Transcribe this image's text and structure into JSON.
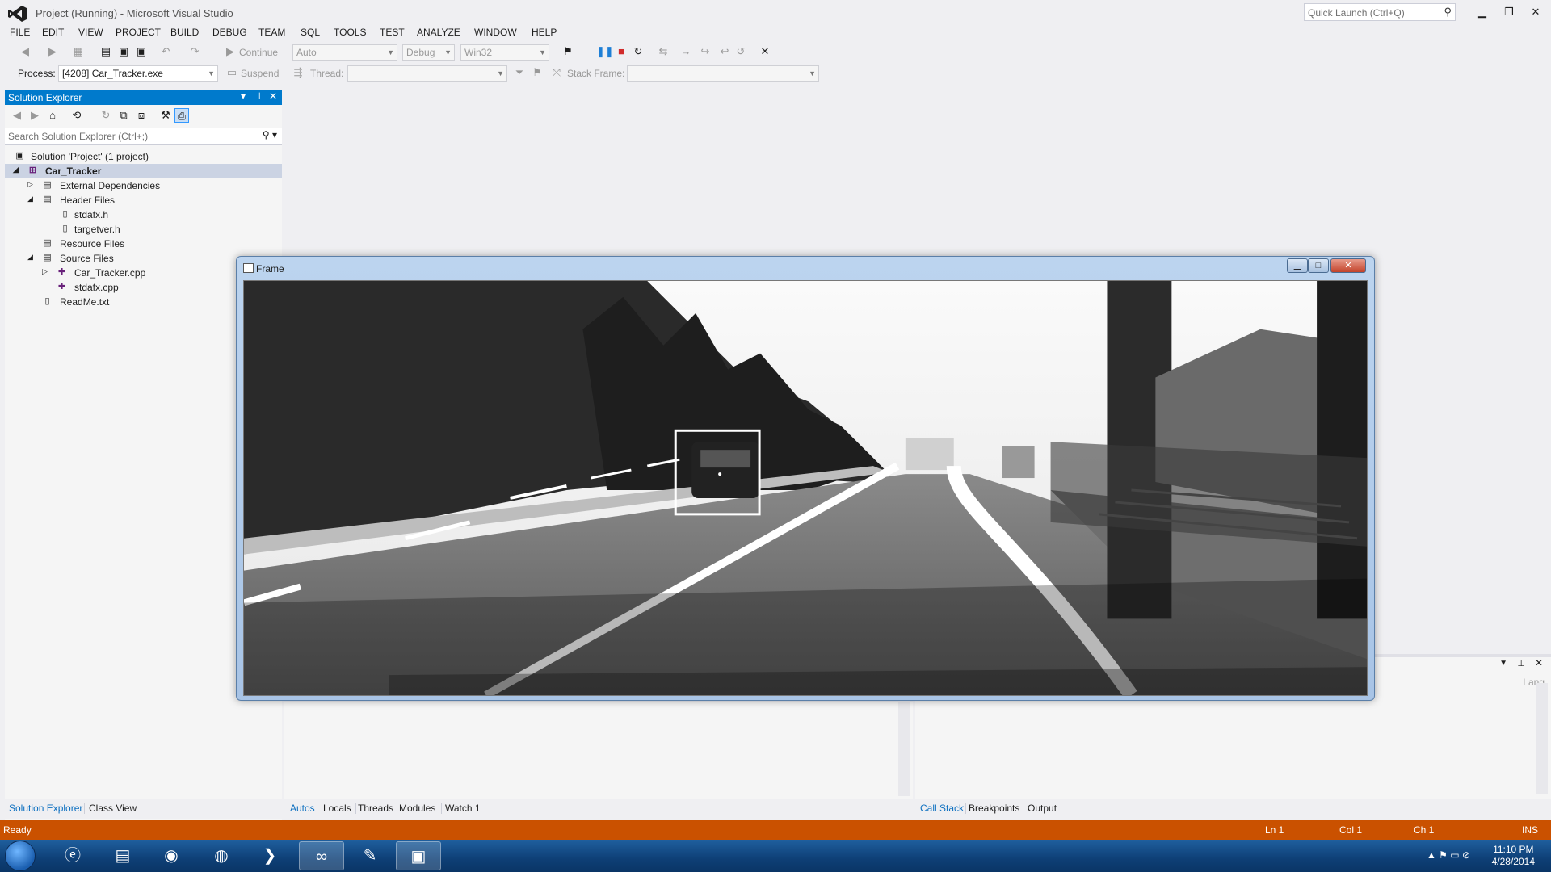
{
  "window": {
    "title": "Project (Running) - Microsoft Visual Studio",
    "quick_launch_placeholder": "Quick Launch (Ctrl+Q)"
  },
  "menu": [
    "FILE",
    "EDIT",
    "VIEW",
    "PROJECT",
    "BUILD",
    "DEBUG",
    "TEAM",
    "SQL",
    "TOOLS",
    "TEST",
    "ANALYZE",
    "WINDOW",
    "HELP"
  ],
  "toolbar": {
    "continue_label": "Continue",
    "config_auto": "Auto",
    "config_debug": "Debug",
    "platform": "Win32",
    "process_label": "Process:",
    "process_value": "[4208] Car_Tracker.exe",
    "suspend_label": "Suspend",
    "thread_label": "Thread:",
    "stack_frame_label": "Stack Frame:"
  },
  "solution_explorer": {
    "title": "Solution Explorer",
    "search_placeholder": "Search Solution Explorer (Ctrl+;)",
    "items": [
      {
        "label": "Solution 'Project' (1 project)"
      },
      {
        "label": "Car_Tracker"
      },
      {
        "label": "External Dependencies"
      },
      {
        "label": "Header Files"
      },
      {
        "label": "stdafx.h"
      },
      {
        "label": "targetver.h"
      },
      {
        "label": "Resource Files"
      },
      {
        "label": "Source Files"
      },
      {
        "label": "Car_Tracker.cpp"
      },
      {
        "label": "stdafx.cpp"
      },
      {
        "label": "ReadMe.txt"
      }
    ]
  },
  "bottom_tabs": {
    "left": [
      "Solution Explorer",
      "Class View"
    ],
    "middle": [
      "Autos",
      "Locals",
      "Threads",
      "Modules",
      "Watch 1"
    ],
    "right": [
      "Call Stack",
      "Breakpoints",
      "Output"
    ]
  },
  "panel_partial_text": "Lang",
  "frame_window": {
    "title": "Frame"
  },
  "status": {
    "ready": "Ready",
    "ln": "Ln 1",
    "col": "Col 1",
    "ch": "Ch 1",
    "ins": "INS"
  },
  "clock": {
    "time": "11:10 PM",
    "date": "4/28/2014"
  },
  "colors": {
    "accent": "#007acc",
    "status_bar": "#ca5100",
    "selection": "#cbd3e3"
  }
}
